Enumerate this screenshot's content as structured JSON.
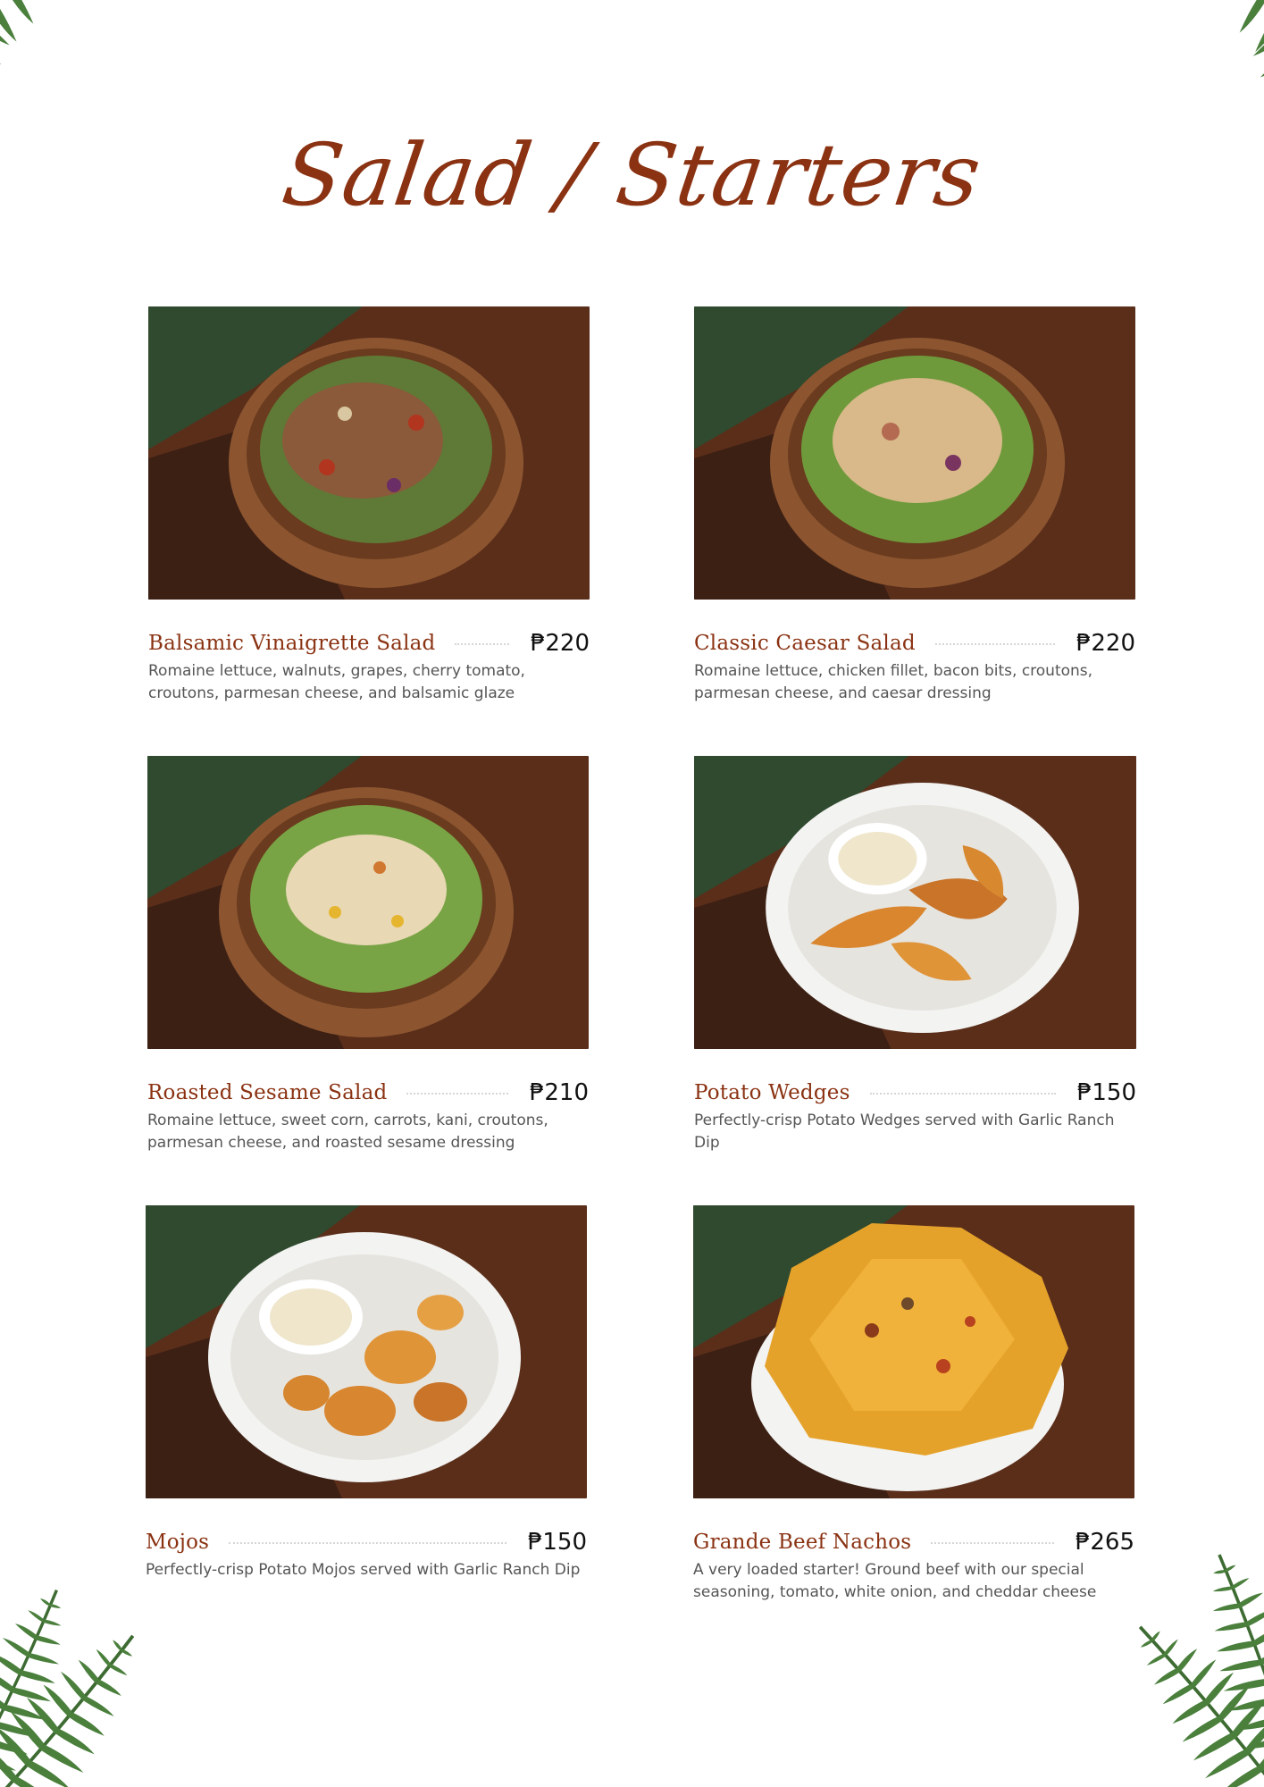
{
  "title": "Salad / Starters",
  "menu": [
    {
      "name": "Balsamic Vinaigrette Salad",
      "price": "₱220",
      "description": "Romaine lettuce, walnuts, grapes, cherry tomato, croutons, parmesan cheese, and balsamic glaze"
    },
    {
      "name": "Classic Caesar Salad",
      "price": "₱220",
      "description": "Romaine lettuce, chicken fillet, bacon bits, croutons, parmesan cheese, and caesar dressing"
    },
    {
      "name": "Roasted Sesame Salad",
      "price": "₱210",
      "description": "Romaine lettuce, sweet corn, carrots, kani, croutons, parmesan cheese, and roasted sesame dressing"
    },
    {
      "name": "Potato Wedges",
      "price": "₱150",
      "description": "Perfectly-crisp Potato Wedges served with Garlic Ranch Dip"
    },
    {
      "name": "Mojos",
      "price": "₱150",
      "description": "Perfectly-crisp Potato Mojos served with Garlic Ranch Dip"
    },
    {
      "name": "Grande Beef Nachos",
      "price": "₱265",
      "description": "A very loaded starter! Ground beef with our special seasoning, tomato, white onion, and cheddar cheese"
    }
  ]
}
